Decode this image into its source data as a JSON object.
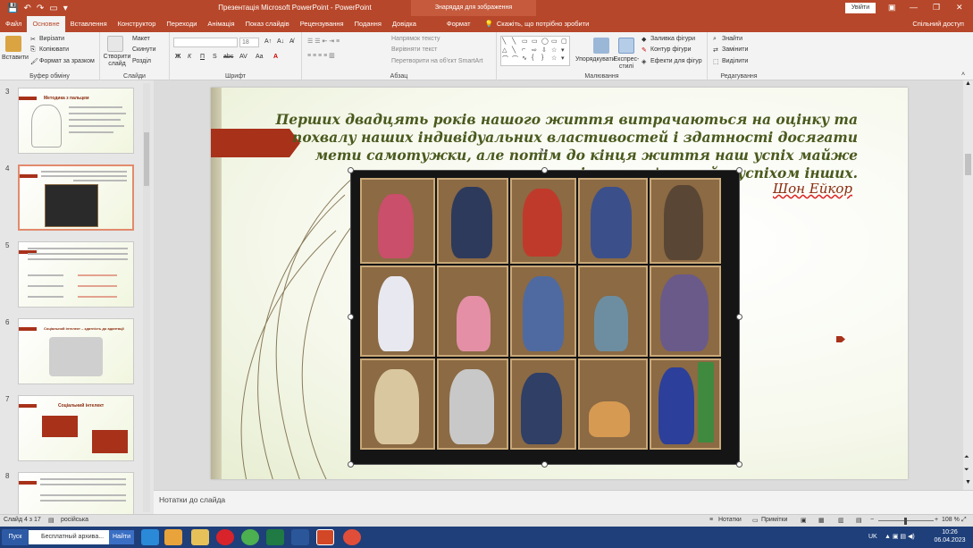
{
  "window": {
    "title": "Презентація Microsoft PowerPoint  -  PowerPoint",
    "contextual_tab": "Знаряддя для зображення",
    "signin": "Увійти"
  },
  "tabs": [
    "Файл",
    "Основне",
    "Вставлення",
    "Конструктор",
    "Переходи",
    "Анімація",
    "Показ слайдів",
    "Рецензування",
    "Подання",
    "Довідка",
    "Формат"
  ],
  "active_tab": "Основне",
  "tell_me": "Скажіть, що потрібно зробити",
  "share": "Спільний доступ",
  "ribbon": {
    "clipboard": {
      "label": "Буфер обміну",
      "paste": "Вставити",
      "cut": "Вирізати",
      "copy": "Копіювати",
      "format_painter": "Формат за зразком"
    },
    "slides": {
      "label": "Слайди",
      "new_slide": "Створити слайд",
      "layout": "Макет",
      "reset": "Скинути",
      "section": "Розділ"
    },
    "font": {
      "label": "Шрифт",
      "size": "18",
      "buttons": [
        "Ж",
        "К",
        "П",
        "S",
        "abc",
        "AV",
        "Aa",
        "A"
      ]
    },
    "paragraph": {
      "label": "Абзац",
      "text_direction": "Напрямок тексту",
      "align_text": "Вирівняти текст",
      "smartart": "Перетворити на об'єкт SmartArt"
    },
    "drawing": {
      "label": "Малювання",
      "arrange": "Упорядкувати",
      "quick_styles": "Експрес-стилі",
      "fill": "Заливка фігури",
      "outline": "Контур фігури",
      "effects": "Ефекти для фігур"
    },
    "editing": {
      "label": "Редагування",
      "find": "Знайти",
      "replace": "Замінити",
      "select": "Виділити"
    }
  },
  "thumbnails": [
    {
      "num": "3",
      "title": "Методика з пальцем"
    },
    {
      "num": "4",
      "title": ""
    },
    {
      "num": "5",
      "title": ""
    },
    {
      "num": "6",
      "title": "Соціальний інтелект – здатність до адаптації"
    },
    {
      "num": "7",
      "title": "Соціальний інтелект"
    },
    {
      "num": "8",
      "title": ""
    }
  ],
  "slide": {
    "quote": "Перших двадцять років нашого життя витрачаються на оцінку та похвалу наших індивідуальних властивостей і здатності досягати мети самотужки, але потім до кінця життя наш успіх майже повністю пов'язаний з успіхом інших.",
    "author": "Шон Ейкор"
  },
  "notes_placeholder": "Нотатки до слайда",
  "status": {
    "slide_counter": "Слайд 4 з 17",
    "language": "російська",
    "notes": "Нотатки",
    "comments": "Примітки",
    "zoom": "108 %"
  },
  "taskbar": {
    "start": "Пуск",
    "search_text": "Бесплатный архива...",
    "search_button": "Найти",
    "lang": "UK",
    "time": "10:26",
    "date": "06.04.2023"
  },
  "colors": {
    "accent": "#b7472a",
    "quote_text": "#4a5a1e",
    "flag": "#a8311a"
  }
}
